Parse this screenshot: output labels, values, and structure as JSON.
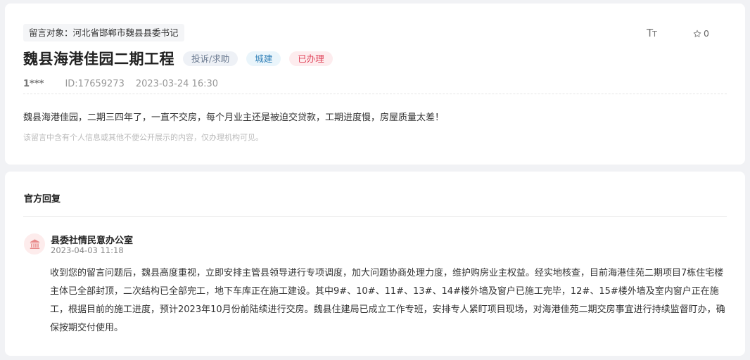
{
  "post": {
    "target_label": "留言对象：河北省邯郸市魏县县委书记",
    "font_toggle_big": "T",
    "font_toggle_small": "T",
    "favorites_count": "0",
    "title": "魏县海港佳园二期工程",
    "tags": {
      "type": "投诉/求助",
      "domain": "城建",
      "status": "已办理"
    },
    "user": "1***",
    "id_text": "ID:17659273",
    "datetime": "2023-03-24 16:30",
    "content": "魏县海港佳园，二期三四年了，一直不交房，每个月业主还是被迫交贷款，工期进度慢，房屋质量太差！",
    "privacy_note": "该留言中含有个人信息或其他不便公开展示的内容，仅办理机构可见。"
  },
  "reply": {
    "header": "官方回复",
    "org_name": "县委社情民意办公室",
    "datetime": "2023-04-03 11:18",
    "body": "收到您的留言问题后，魏县高度重视，立即安排主管县领导进行专项调度，加大问题协商处理力度，维护购房业主权益。经实地核查，目前海港佳苑二期项目7栋住宅楼主体已全部封顶，二次结构已全部完工，地下车库正在施工建设。其中9#、10#、11#、13#、14#楼外墙及窗户已施工完毕，12#、15#楼外墙及室内窗户正在施工，根据目前的施工进度，预计2023年10月份前陆续进行交房。魏县住建局已成立工作专班，安排专人紧盯项目现场，对海港佳苑二期交房事宜进行持续监督盯办，确保按期交付使用。"
  },
  "icons": {
    "font_size": "font-size-icon",
    "favorite": "star-icon",
    "org": "government-building-icon"
  },
  "colors": {
    "status_red": "#e0445a",
    "domain_blue": "#2f7fb7",
    "org_avatar_bg": "#fdecec",
    "org_icon": "#e88a8a"
  }
}
